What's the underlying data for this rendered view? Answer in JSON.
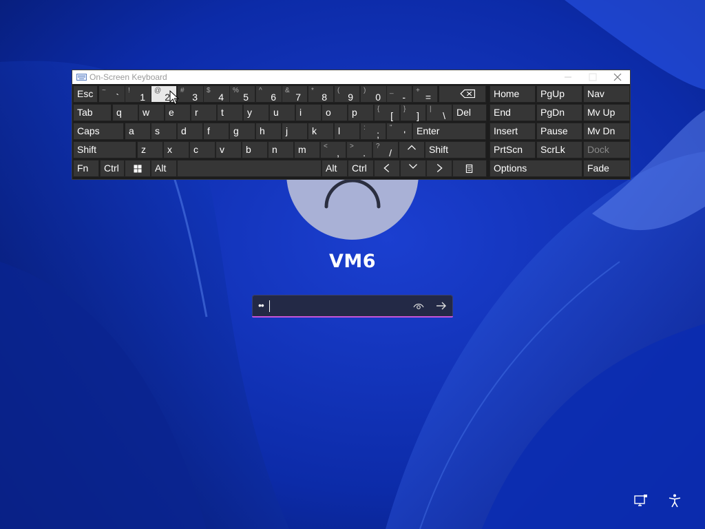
{
  "osk": {
    "title": "On-Screen Keyboard",
    "rows": [
      [
        {
          "name": "key-esc",
          "label": "Esc"
        },
        {
          "name": "key-tilde",
          "shift": "~",
          "char": "`"
        },
        {
          "name": "key-1",
          "shift": "!",
          "char": "1"
        },
        {
          "name": "key-2",
          "shift": "@",
          "char": "2",
          "pressed": true
        },
        {
          "name": "key-3",
          "shift": "#",
          "char": "3"
        },
        {
          "name": "key-4",
          "shift": "$",
          "char": "4"
        },
        {
          "name": "key-5",
          "shift": "%",
          "char": "5"
        },
        {
          "name": "key-6",
          "shift": "^",
          "char": "6"
        },
        {
          "name": "key-7",
          "shift": "&",
          "char": "7"
        },
        {
          "name": "key-8",
          "shift": "*",
          "char": "8"
        },
        {
          "name": "key-9",
          "shift": "(",
          "char": "9"
        },
        {
          "name": "key-0",
          "shift": ")",
          "char": "0"
        },
        {
          "name": "key-minus",
          "shift": "_",
          "char": "-"
        },
        {
          "name": "key-equals",
          "shift": "+",
          "char": "="
        },
        {
          "name": "key-backspace",
          "icon": "backspace-icon"
        },
        {
          "name": "key-home",
          "label": "Home"
        },
        {
          "name": "key-pgup",
          "label": "PgUp"
        },
        {
          "name": "key-nav",
          "label": "Nav"
        }
      ],
      [
        {
          "name": "key-tab",
          "label": "Tab"
        },
        {
          "name": "key-q",
          "label": "q"
        },
        {
          "name": "key-w",
          "label": "w"
        },
        {
          "name": "key-e",
          "label": "e"
        },
        {
          "name": "key-r",
          "label": "r"
        },
        {
          "name": "key-t",
          "label": "t"
        },
        {
          "name": "key-y",
          "label": "y"
        },
        {
          "name": "key-u",
          "label": "u"
        },
        {
          "name": "key-i",
          "label": "i"
        },
        {
          "name": "key-o",
          "label": "o"
        },
        {
          "name": "key-p",
          "label": "p"
        },
        {
          "name": "key-lbracket",
          "shift": "{",
          "char": "["
        },
        {
          "name": "key-rbracket",
          "shift": "}",
          "char": "]"
        },
        {
          "name": "key-backslash",
          "shift": "|",
          "char": "\\"
        },
        {
          "name": "key-del",
          "label": "Del"
        },
        {
          "name": "key-end",
          "label": "End"
        },
        {
          "name": "key-pgdn",
          "label": "PgDn"
        },
        {
          "name": "key-mvup",
          "label": "Mv Up"
        }
      ],
      [
        {
          "name": "key-caps",
          "label": "Caps"
        },
        {
          "name": "key-a",
          "label": "a"
        },
        {
          "name": "key-s",
          "label": "s"
        },
        {
          "name": "key-d",
          "label": "d"
        },
        {
          "name": "key-f",
          "label": "f"
        },
        {
          "name": "key-g",
          "label": "g"
        },
        {
          "name": "key-h",
          "label": "h"
        },
        {
          "name": "key-j",
          "label": "j"
        },
        {
          "name": "key-k",
          "label": "k"
        },
        {
          "name": "key-l",
          "label": "l"
        },
        {
          "name": "key-semicolon",
          "shift": ":",
          "char": ";"
        },
        {
          "name": "key-quote",
          "shift": "\"",
          "char": "'"
        },
        {
          "name": "key-enter",
          "label": "Enter"
        },
        {
          "name": "key-insert",
          "label": "Insert"
        },
        {
          "name": "key-pause",
          "label": "Pause"
        },
        {
          "name": "key-mvdn",
          "label": "Mv Dn"
        }
      ],
      [
        {
          "name": "key-shift-left",
          "label": "Shift"
        },
        {
          "name": "key-z",
          "label": "z"
        },
        {
          "name": "key-x",
          "label": "x"
        },
        {
          "name": "key-c",
          "label": "c"
        },
        {
          "name": "key-v",
          "label": "v"
        },
        {
          "name": "key-b",
          "label": "b"
        },
        {
          "name": "key-n",
          "label": "n"
        },
        {
          "name": "key-m",
          "label": "m"
        },
        {
          "name": "key-comma",
          "shift": "<",
          "char": ","
        },
        {
          "name": "key-period",
          "shift": ">",
          "char": "."
        },
        {
          "name": "key-slash",
          "shift": "?",
          "char": "/"
        },
        {
          "name": "key-up",
          "icon": "chevron-up-icon"
        },
        {
          "name": "key-shift-right",
          "label": "Shift"
        },
        {
          "name": "key-prtscn",
          "label": "PrtScn"
        },
        {
          "name": "key-scrlk",
          "label": "ScrLk"
        },
        {
          "name": "key-dock",
          "label": "Dock",
          "disabled": true
        }
      ],
      [
        {
          "name": "key-fn",
          "label": "Fn"
        },
        {
          "name": "key-ctrl-left",
          "label": "Ctrl"
        },
        {
          "name": "key-win",
          "icon": "windows-icon"
        },
        {
          "name": "key-alt-left",
          "label": "Alt"
        },
        {
          "name": "key-space",
          "label": ""
        },
        {
          "name": "key-alt-right",
          "label": "Alt"
        },
        {
          "name": "key-ctrl-right",
          "label": "Ctrl"
        },
        {
          "name": "key-left",
          "icon": "chevron-left-icon"
        },
        {
          "name": "key-down",
          "icon": "chevron-down-icon"
        },
        {
          "name": "key-right",
          "icon": "chevron-right-icon"
        },
        {
          "name": "key-menu",
          "icon": "menu-key-icon"
        },
        {
          "name": "key-options",
          "label": "Options"
        },
        {
          "name": "key-fade",
          "label": "Fade"
        }
      ]
    ]
  },
  "lock": {
    "username": "VM6",
    "password_mask": "••",
    "reveal_icon": "eye-icon",
    "submit_icon": "arrow-right-icon"
  },
  "tray": {
    "network_icon": "network-icon",
    "accessibility_icon": "accessibility-icon"
  },
  "colors": {
    "wallpaper": "#0a2a9a",
    "osk_key": "#363636",
    "osk_pressed": "#e8e8e8",
    "focus_accent": "#c855d8"
  }
}
